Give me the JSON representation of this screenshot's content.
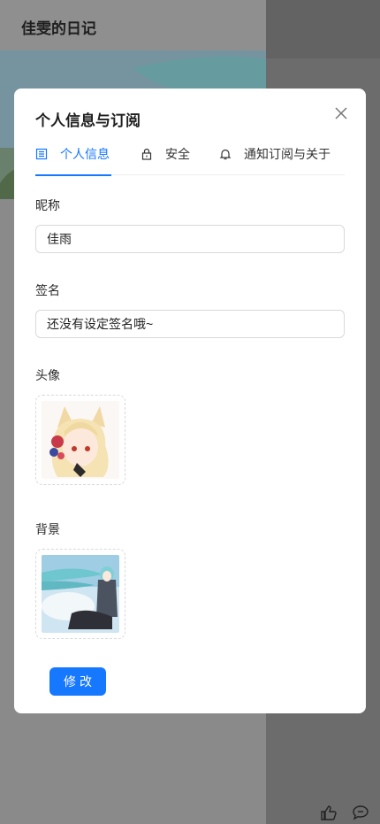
{
  "background": {
    "title": "佳雯的日记"
  },
  "modal": {
    "title": "个人信息与订阅",
    "tabs": [
      {
        "label": "个人信息",
        "icon": "profile-icon",
        "active": true
      },
      {
        "label": "安全",
        "icon": "lock-icon",
        "active": false
      },
      {
        "label": "通知订阅与关于",
        "icon": "bell-icon",
        "active": false
      }
    ],
    "form": {
      "nickname_label": "昵称",
      "nickname_value": "佳雨",
      "signature_label": "签名",
      "signature_value": "还没有设定签名哦~",
      "avatar_label": "头像",
      "background_label": "背景"
    },
    "submit_label": "修改"
  },
  "colors": {
    "accent": "#1677ff",
    "overlay": "#6f6f6f"
  }
}
